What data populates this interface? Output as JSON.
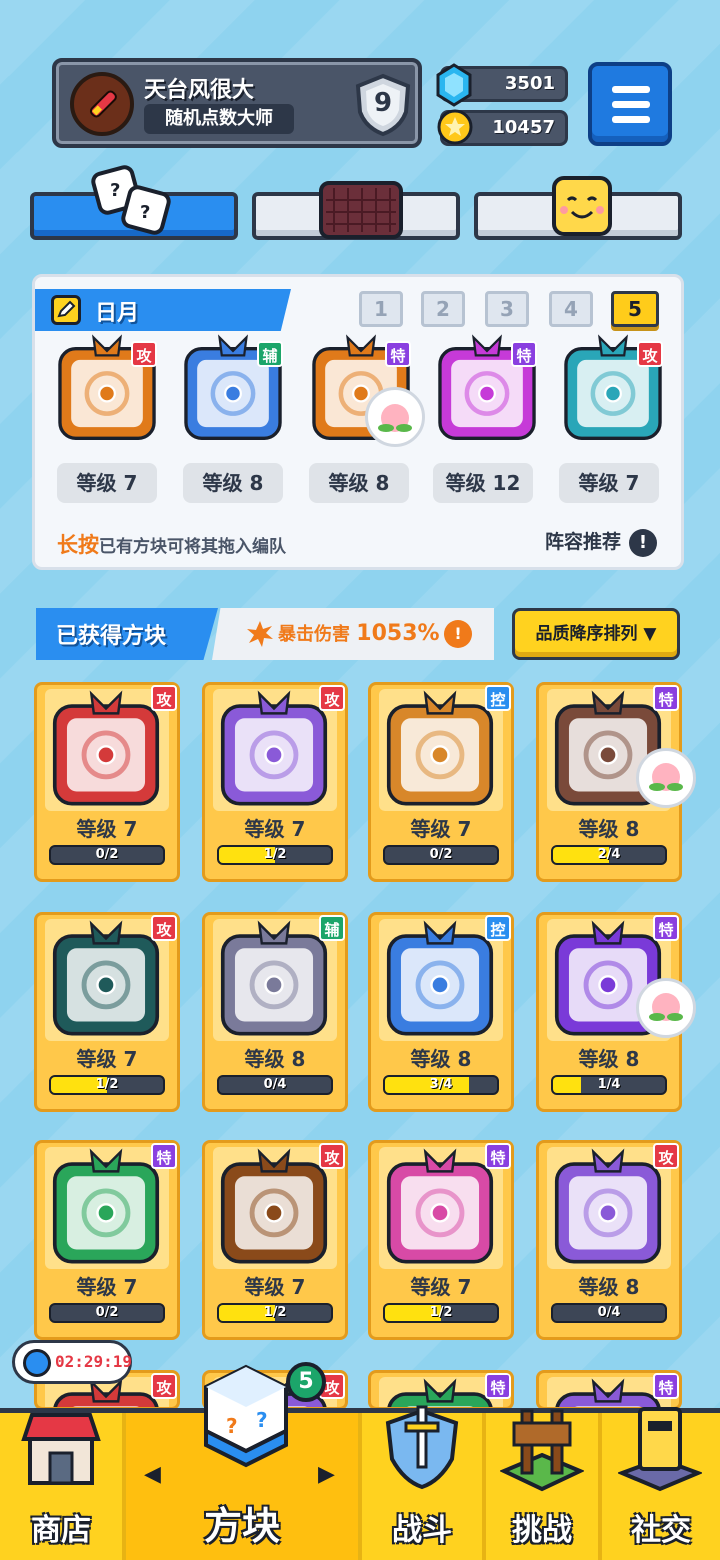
{
  "profile": {
    "name": "天台风很大",
    "title": "随机点数大师",
    "rank": "9"
  },
  "currency": {
    "gems": "3501",
    "coins": "10457"
  },
  "lineup": {
    "name": "日月",
    "tabs": [
      "1",
      "2",
      "3",
      "4",
      "5"
    ],
    "active_tab": "5",
    "slots": [
      {
        "tag": "攻",
        "level": "等级 7",
        "color": "#e07a1a"
      },
      {
        "tag": "辅",
        "level": "等级 8",
        "color": "#3a7de0"
      },
      {
        "tag": "特",
        "level": "等级 8",
        "color": "#e07a1a"
      },
      {
        "tag": "特",
        "level": "等级 12",
        "color": "#c63ad8"
      },
      {
        "tag": "攻",
        "level": "等级 7",
        "color": "#2aa6b8"
      }
    ],
    "hint_em": "长按",
    "hint_rest": "已有方块可将其拖入编队",
    "recommend": "阵容推荐"
  },
  "owned": {
    "title": "已获得方块",
    "crit_label": "暴击伤害",
    "crit_value": "1053%",
    "sort_label": "品质降序排列 ▼",
    "cards": [
      {
        "tag": "攻",
        "level": "等级 7",
        "progress": "0/2",
        "fill": 0.0,
        "color": "#d43a3a"
      },
      {
        "tag": "攻",
        "level": "等级 7",
        "progress": "1/2",
        "fill": 0.5,
        "color": "#8a5ad8"
      },
      {
        "tag": "控",
        "level": "等级 7",
        "progress": "0/2",
        "fill": 0.0,
        "color": "#d8872a"
      },
      {
        "tag": "特",
        "level": "等级 8",
        "progress": "2/4",
        "fill": 0.5,
        "color": "#7a4a3a"
      },
      {
        "tag": "攻",
        "level": "等级 7",
        "progress": "1/2",
        "fill": 0.5,
        "color": "#1f5a5a"
      },
      {
        "tag": "辅",
        "level": "等级 8",
        "progress": "0/4",
        "fill": 0.0,
        "color": "#7a7a9a"
      },
      {
        "tag": "控",
        "level": "等级 8",
        "progress": "3/4",
        "fill": 0.75,
        "color": "#3a7de0"
      },
      {
        "tag": "特",
        "level": "等级 8",
        "progress": "1/4",
        "fill": 0.25,
        "color": "#7a3ad8"
      },
      {
        "tag": "特",
        "level": "等级 7",
        "progress": "0/2",
        "fill": 0.0,
        "color": "#2aa65a"
      },
      {
        "tag": "攻",
        "level": "等级 7",
        "progress": "1/2",
        "fill": 0.5,
        "color": "#8a4a1a"
      },
      {
        "tag": "特",
        "level": "等级 7",
        "progress": "1/2",
        "fill": 0.5,
        "color": "#d84aa6"
      },
      {
        "tag": "攻",
        "level": "等级 8",
        "progress": "0/4",
        "fill": 0.0,
        "color": "#8a5ad8"
      },
      {
        "tag": "攻",
        "level": "",
        "progress": "",
        "fill": 0.0,
        "color": "#d43a3a"
      },
      {
        "tag": "攻",
        "level": "",
        "progress": "",
        "fill": 0.0,
        "color": "#8a5ad8"
      },
      {
        "tag": "特",
        "level": "",
        "progress": "",
        "fill": 0.0,
        "color": "#2aa65a"
      },
      {
        "tag": "特",
        "level": "",
        "progress": "",
        "fill": 0.0,
        "color": "#8a5ad8"
      }
    ]
  },
  "timer": "02:29:19",
  "nav": {
    "shop": "商店",
    "blocks": "方块",
    "battle": "战斗",
    "challenge": "挑战",
    "social": "社交",
    "blocks_badge": "5"
  },
  "icons": {
    "gem": "gem-icon",
    "coin": "coin-icon",
    "menu": "hamburger-menu-icon",
    "dice": "dice-icon",
    "board": "board-icon",
    "emoji": "smiley-block-icon",
    "pencil": "pencil-icon",
    "peach": "peach-icon"
  }
}
